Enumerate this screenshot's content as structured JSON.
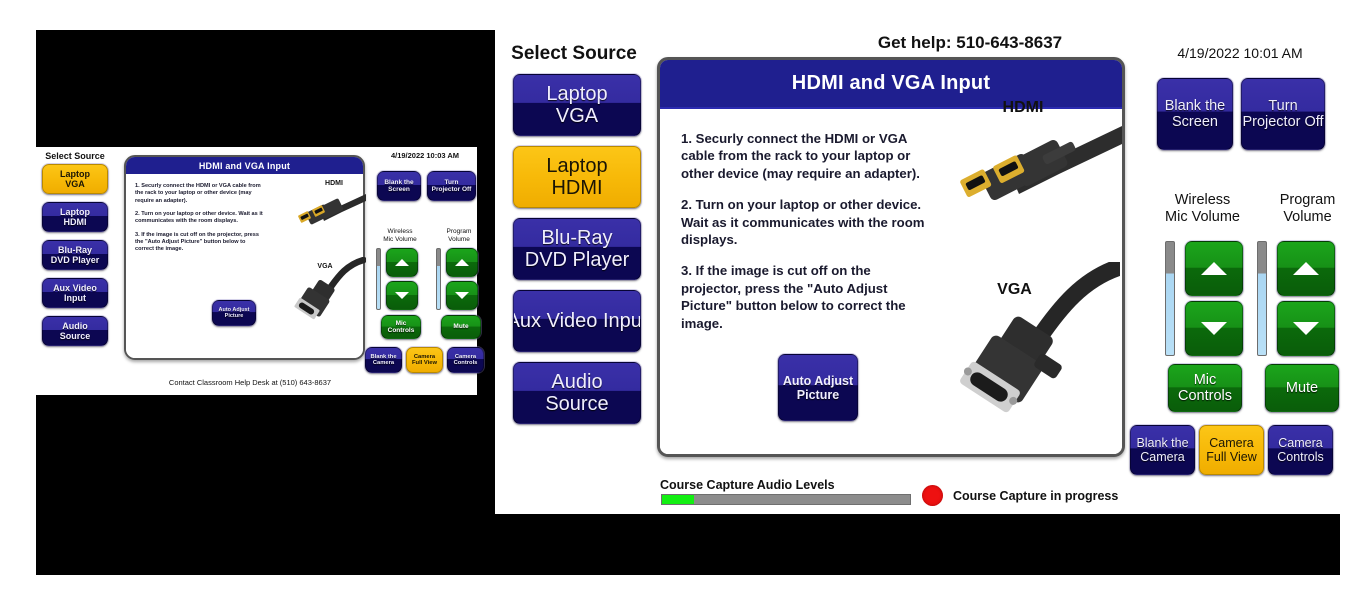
{
  "theme": {
    "navy": "#0c0752",
    "navy_top": "#3a30a8",
    "gold": "#f7b908",
    "green": "#179117",
    "header_blue": "#1f1f8f",
    "meter_green": "#12ef12",
    "record_red": "#ee1111",
    "page_background": "#000000"
  },
  "large_panel": {
    "select_source_label": "Select Source",
    "help_text": "Get help: 510-643-8637",
    "datetime": "4/19/2022 10:01 AM",
    "sources": [
      {
        "line1": "Laptop",
        "line2": "VGA",
        "selected": false
      },
      {
        "line1": "Laptop",
        "line2": "HDMI",
        "selected": true
      },
      {
        "line1": "Blu-Ray",
        "line2": "DVD Player",
        "selected": false
      },
      {
        "line1": "Aux Video Input",
        "line2": "",
        "selected": false
      },
      {
        "line1": "Audio",
        "line2": "Source",
        "selected": false
      }
    ],
    "card": {
      "title": "HDMI and VGA Input",
      "steps": [
        "1. Securly connect the HDMI or VGA cable from the rack to your laptop or other device (may require an adapter).",
        "2. Turn on your laptop or other device. Wait as it communicates with the room displays.",
        "3. If the image is cut off on the projector, press the \"Auto Adjust Picture\" button below to correct the image."
      ],
      "auto_adjust_line1": "Auto Adjust",
      "auto_adjust_line2": "Picture",
      "hdmi_caption": "HDMI",
      "vga_caption": "VGA"
    },
    "controls": {
      "blank_screen_line1": "Blank the",
      "blank_screen_line2": "Screen",
      "projector_off_line1": "Turn",
      "projector_off_line2": "Projector Off",
      "mic_volume_line1": "Wireless",
      "mic_volume_line2": "Mic Volume",
      "program_volume_line1": "Program",
      "program_volume_line2": "Volume",
      "mic_controls_line1": "Mic",
      "mic_controls_line2": "Controls",
      "mute_label": "Mute",
      "blank_camera_line1": "Blank the",
      "blank_camera_line2": "Camera",
      "camera_full_view_line1": "Camera",
      "camera_full_view_line2": "Full View",
      "camera_controls_line1": "Camera",
      "camera_controls_line2": "Controls"
    },
    "status": {
      "audio_levels_label": "Course Capture Audio Levels",
      "audio_level_percent": 13,
      "capture_status": "Course Capture in progress"
    }
  },
  "small_panel": {
    "select_source_label": "Select Source",
    "datetime": "4/19/2022 10:03 AM",
    "footer": "Contact Classroom Help Desk at (510) 643-8637",
    "sources": [
      {
        "line1": "Laptop",
        "line2": "VGA",
        "selected": true
      },
      {
        "line1": "Laptop",
        "line2": "HDMI",
        "selected": false
      },
      {
        "line1": "Blu-Ray",
        "line2": "DVD Player",
        "selected": false
      },
      {
        "line1": "Aux Video Input",
        "line2": "",
        "selected": false
      },
      {
        "line1": "Audio",
        "line2": "Source",
        "selected": false
      }
    ],
    "card": {
      "title": "HDMI and VGA Input",
      "steps": [
        "1. Securly connect the HDMI or VGA cable from the rack to your laptop or other device (may require an adapter).",
        "2. Turn on your laptop or other device. Wait as it communicates with the room displays.",
        "3. If the image is cut off on the projector, press the \"Auto Adjust Picture\" button below to correct the image."
      ],
      "auto_adjust_line1": "Auto Adjust",
      "auto_adjust_line2": "Picture",
      "hdmi_caption": "HDMI",
      "vga_caption": "VGA"
    },
    "controls": {
      "blank_screen_line1": "Blank the",
      "blank_screen_line2": "Screen",
      "projector_off_line1": "Turn",
      "projector_off_line2": "Projector Off",
      "mic_volume_line1": "Wireless",
      "mic_volume_line2": "Mic Volume",
      "program_volume_line1": "Program",
      "program_volume_line2": "Volume",
      "mic_controls_line1": "Mic",
      "mic_controls_line2": "Controls",
      "mute_label": "Mute",
      "blank_camera_line1": "Blank the",
      "blank_camera_line2": "Camera",
      "camera_full_view_line1": "Camera",
      "camera_full_view_line2": "Full View",
      "camera_controls_line1": "Camera",
      "camera_controls_line2": "Controls"
    }
  }
}
